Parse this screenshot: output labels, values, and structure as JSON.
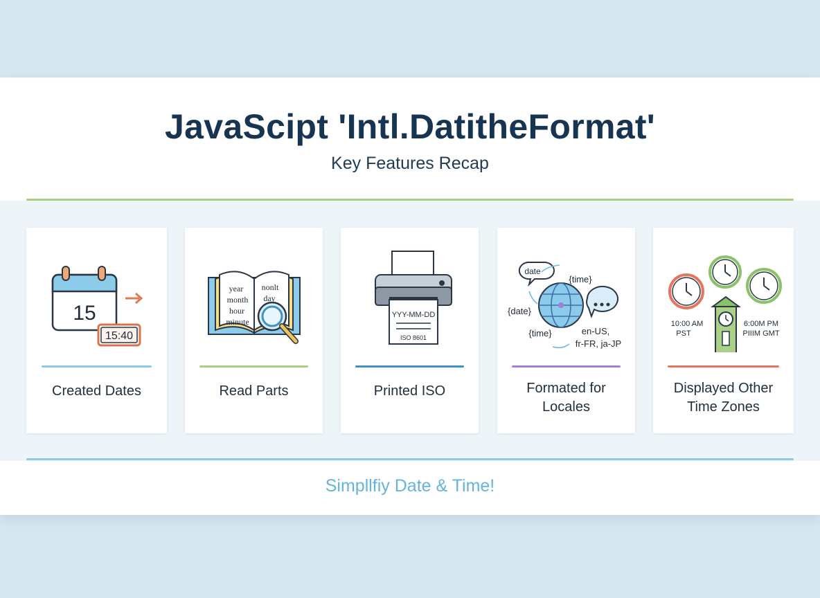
{
  "header": {
    "title": "JavaScipt 'Intl.DatitheFormat'",
    "subtitle": "Key Features Recap"
  },
  "colors": {
    "title": "#173450",
    "green_rule": "#a9cf82",
    "blue_rule": "#8fc8e6",
    "tagline": "#65b4de"
  },
  "cards": [
    {
      "label": "Created Dates",
      "accent": "#8cc8e6",
      "icon": "calendar-clock-icon",
      "icon_text": {
        "day": "15",
        "time": "15:40"
      }
    },
    {
      "label": "Read Parts",
      "accent": "#a9cf82",
      "icon": "book-magnifier-icon",
      "icon_text": {
        "w1": "year",
        "w2": "month",
        "w3": "hour",
        "w4": "minute",
        "w5": "nonlt",
        "w6": "day"
      }
    },
    {
      "label": "Printed ISO",
      "accent": "#3f92c4",
      "icon": "printer-icon",
      "icon_text": {
        "line1": "YYY-MM-DD",
        "line2": "ISO 8601"
      }
    },
    {
      "label": "Formated for\nLocales",
      "accent": "#a27fd6",
      "icon": "globe-locales-icon",
      "icon_text": {
        "b1": "date",
        "b2": "{time}",
        "b3": "{date}",
        "b4": "{time}",
        "loc1": "en-US,",
        "loc2": "fr-FR, ja-JP"
      }
    },
    {
      "label": "Displayed Other\nTime Zones",
      "accent": "#e8735f",
      "icon": "world-clocks-icon",
      "icon_text": {
        "t1": "10:00 AM",
        "t2": "PST",
        "t3": "6:00M PM",
        "t4": "PIIIM GMT"
      }
    }
  ],
  "footer": {
    "tagline": "Simpllfiy Date & Time!"
  }
}
